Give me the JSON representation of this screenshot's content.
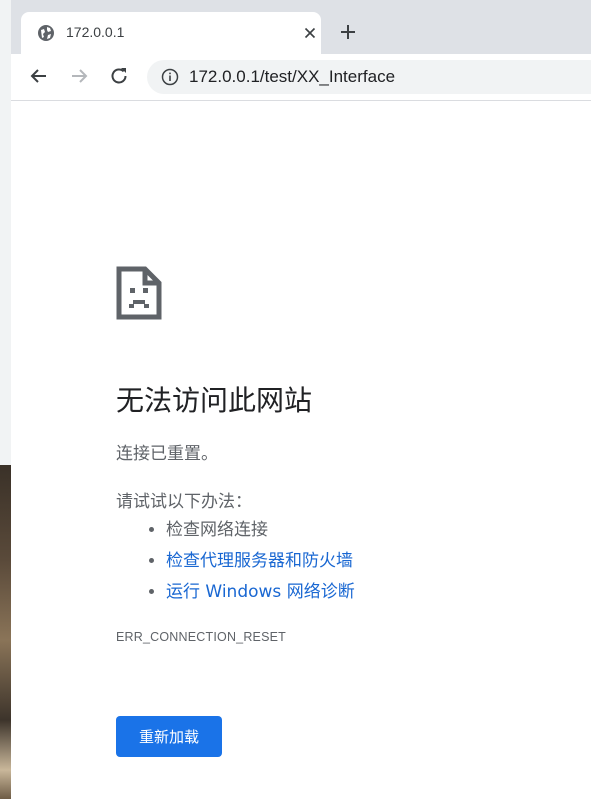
{
  "tab": {
    "title": "172.0.0.1",
    "favicon": "globe-icon",
    "close": "close-icon"
  },
  "toolbar": {
    "back": "arrow-left-icon",
    "forward": "arrow-right-icon",
    "reload": "reload-icon",
    "info": "info-icon",
    "url": "172.0.0.1/test/XX_Interface"
  },
  "error": {
    "icon": "sad-page-icon",
    "title": "无法访问此网站",
    "description": "连接已重置。",
    "try_label": "请试试以下办法：",
    "suggestions": [
      {
        "label": "检查网络连接",
        "link": false
      },
      {
        "label": "检查代理服务器和防火墙",
        "link": true
      },
      {
        "label": "运行 Windows 网络诊断",
        "link": true
      }
    ],
    "code": "ERR_CONNECTION_RESET",
    "reload_button": "重新加载"
  },
  "colors": {
    "link": "#1967d2",
    "button": "#1a73e8",
    "tabstrip": "#dee1e6"
  }
}
